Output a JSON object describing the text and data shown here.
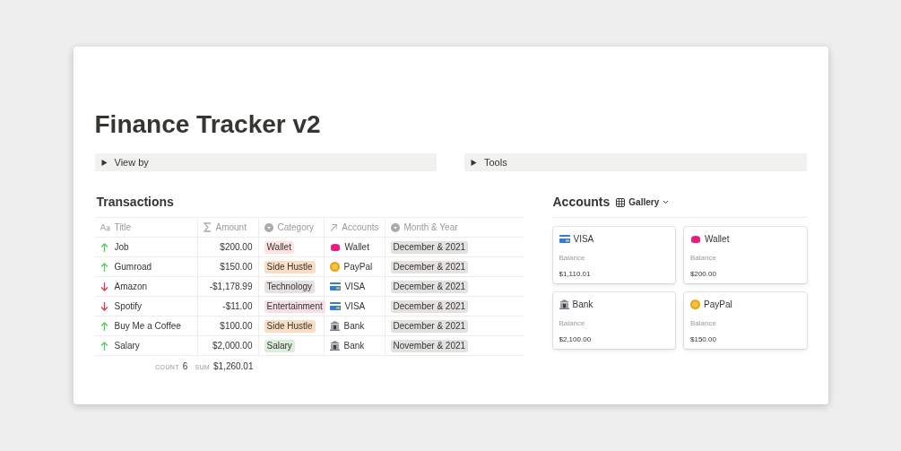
{
  "page": {
    "title": "Finance Tracker v2"
  },
  "toggles": [
    {
      "label": "View by",
      "expanded": false
    },
    {
      "label": "Tools",
      "expanded": false
    }
  ],
  "transactions": {
    "title": "Transactions",
    "columns": [
      {
        "label": "Title",
        "kind": "text"
      },
      {
        "label": "Amount",
        "kind": "sum"
      },
      {
        "label": "Category",
        "kind": "select"
      },
      {
        "label": "Accounts",
        "kind": "relation"
      },
      {
        "label": "Month & Year",
        "kind": "select"
      }
    ],
    "rows": [
      {
        "kind": "up",
        "title": "Job",
        "amount": "$200.00",
        "category": {
          "label": "Wallet",
          "color": "#fde2e1"
        },
        "account": {
          "kind": "wallet",
          "label": "Wallet"
        },
        "month": "December & 2021"
      },
      {
        "kind": "up",
        "title": "Gumroad",
        "amount": "$150.00",
        "category": {
          "label": "Side Hustle",
          "color": "#fbdcc4"
        },
        "account": {
          "kind": "coin",
          "label": "PayPal"
        },
        "month": "December & 2021"
      },
      {
        "kind": "down",
        "title": "Amazon",
        "amount": "-$1,178.99",
        "category": {
          "label": "Technology",
          "color": "#e3e2e0"
        },
        "account": {
          "kind": "card",
          "label": "VISA"
        },
        "month": "December & 2021"
      },
      {
        "kind": "down",
        "title": "Spotify",
        "amount": "-$11.00",
        "category": {
          "label": "Entertainment",
          "color": "#f5e0e9"
        },
        "account": {
          "kind": "card",
          "label": "VISA"
        },
        "month": "December & 2021"
      },
      {
        "kind": "up",
        "title": "Buy Me a Coffee",
        "amount": "$100.00",
        "category": {
          "label": "Side Hustle",
          "color": "#fbdcc4"
        },
        "account": {
          "kind": "bank",
          "label": "Bank"
        },
        "month": "December & 2021"
      },
      {
        "kind": "up",
        "title": "Salary",
        "amount": "$2,000.00",
        "category": {
          "label": "Salary",
          "color": "#dbeddb"
        },
        "account": {
          "kind": "bank",
          "label": "Bank"
        },
        "month": "November & 2021"
      }
    ],
    "footer": {
      "count_label": "COUNT",
      "count": "6",
      "sum_label": "SUM",
      "sum": "$1,260.01"
    }
  },
  "accounts": {
    "title": "Accounts",
    "view": "Gallery",
    "cards": [
      {
        "kind": "card",
        "name": "VISA",
        "balance_label": "Balance",
        "balance": "$1,110.01"
      },
      {
        "kind": "wallet",
        "name": "Wallet",
        "balance_label": "Balance",
        "balance": "$200.00"
      },
      {
        "kind": "bank",
        "name": "Bank",
        "balance_label": "Balance",
        "balance": "$2,100.00"
      },
      {
        "kind": "coin",
        "name": "PayPal",
        "balance_label": "Balance",
        "balance": "$150.00"
      }
    ]
  }
}
